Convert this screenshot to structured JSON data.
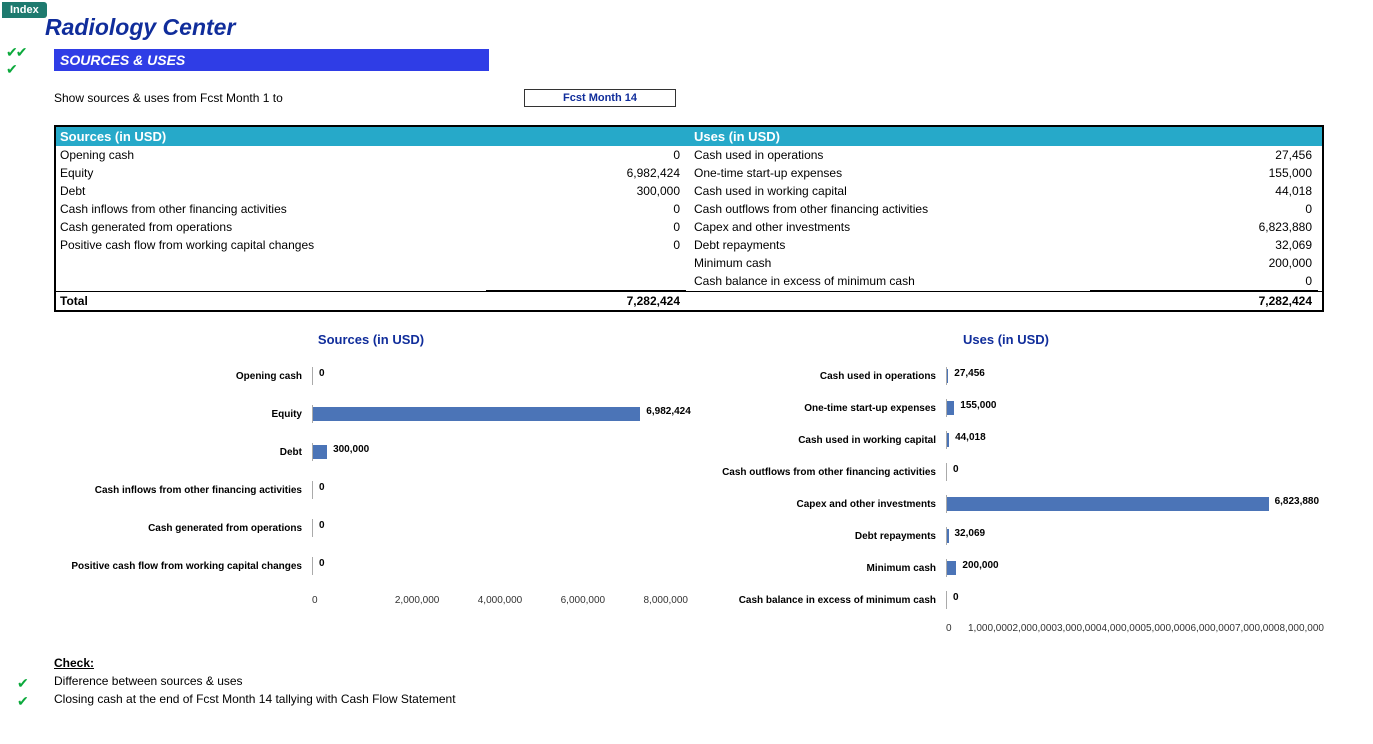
{
  "index_label": "Index",
  "page_title": "Radiology Center",
  "section_title": "SOURCES & USES",
  "controls": {
    "show_label": "Show sources & uses from Fcst Month 1 to",
    "dropdown_value": "Fcst Month 14"
  },
  "headers": {
    "sources": "Sources (in USD)",
    "uses": "Uses (in USD)"
  },
  "sources": [
    {
      "label": "Opening cash",
      "value": "0"
    },
    {
      "label": "Equity",
      "value": "6,982,424"
    },
    {
      "label": "Debt",
      "value": "300,000"
    },
    {
      "label": "Cash inflows from other financing activities",
      "value": "0"
    },
    {
      "label": "Cash generated from operations",
      "value": "0"
    },
    {
      "label": "Positive cash flow from working capital changes",
      "value": "0"
    }
  ],
  "uses": [
    {
      "label": "Cash used in operations",
      "value": "27,456"
    },
    {
      "label": "One-time start-up expenses",
      "value": "155,000"
    },
    {
      "label": "Cash used in working capital",
      "value": "44,018"
    },
    {
      "label": "Cash outflows from other  financing activities",
      "value": "0"
    },
    {
      "label": "Capex and other investments",
      "value": "6,823,880"
    },
    {
      "label": "Debt repayments",
      "value": "32,069"
    },
    {
      "label": "Minimum cash",
      "value": "200,000"
    },
    {
      "label": "Cash balance in excess of minimum cash",
      "value": "0"
    }
  ],
  "total": {
    "label": "Total",
    "sources_total": "7,282,424",
    "uses_total": "7,282,424"
  },
  "charts": {
    "sources_title": "Sources (in USD)",
    "uses_title": "Uses (in USD)",
    "x_ticks_sources": [
      "0",
      "2,000,000",
      "4,000,000",
      "6,000,000",
      "8,000,000"
    ],
    "x_ticks_uses": [
      "0",
      "1,000,000",
      "2,000,000",
      "3,000,000",
      "4,000,000",
      "5,000,000",
      "6,000,000",
      "7,000,000",
      "8,000,000"
    ]
  },
  "check": {
    "heading": "Check:",
    "line1": "Difference between sources & uses",
    "line2": "Closing cash at the end of Fcst Month 14 tallying with Cash Flow Statement"
  },
  "chart_data": [
    {
      "type": "bar",
      "orientation": "horizontal",
      "title": "Sources (in USD)",
      "categories": [
        "Opening cash",
        "Equity",
        "Debt",
        "Cash inflows from other financing activities",
        "Cash generated from operations",
        "Positive cash flow from working capital changes"
      ],
      "values": [
        0,
        6982424,
        300000,
        0,
        0,
        0
      ],
      "xlim": [
        0,
        8000000
      ]
    },
    {
      "type": "bar",
      "orientation": "horizontal",
      "title": "Uses (in USD)",
      "categories": [
        "Cash used in operations",
        "One-time start-up expenses",
        "Cash used in working capital",
        "Cash outflows from other  financing activities",
        "Capex and other investments",
        "Debt repayments",
        "Minimum cash",
        "Cash balance in excess of minimum cash"
      ],
      "values": [
        27456,
        155000,
        44018,
        0,
        6823880,
        32069,
        200000,
        0
      ],
      "xlim": [
        0,
        8000000
      ]
    }
  ]
}
